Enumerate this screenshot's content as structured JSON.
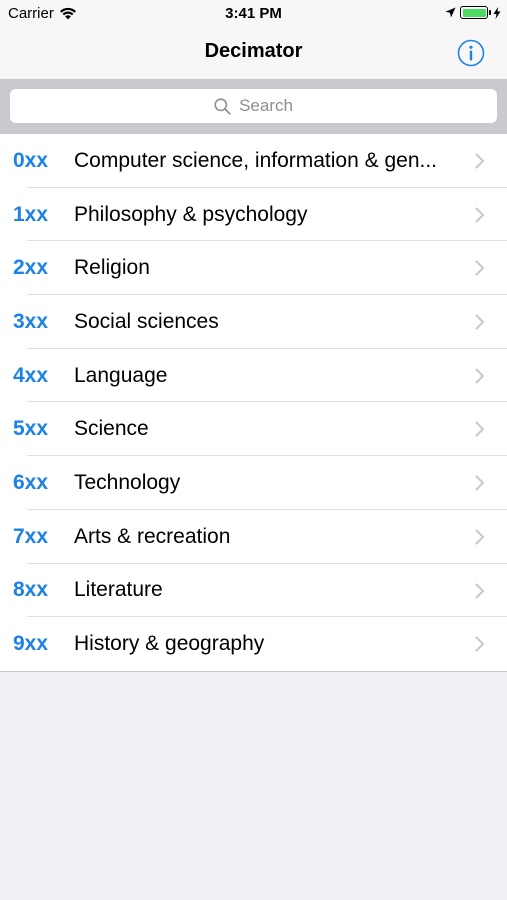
{
  "status_bar": {
    "carrier": "Carrier",
    "time": "3:41 PM",
    "battery_level": 1.0,
    "battery_color": "#4cd964"
  },
  "nav": {
    "title": "Decimator",
    "info_icon": "info-circle-icon"
  },
  "search": {
    "placeholder": "Search",
    "icon": "search-icon"
  },
  "accent_color": "#1d82e6",
  "categories": [
    {
      "code": "0xx",
      "label": "Computer science, information & gen..."
    },
    {
      "code": "1xx",
      "label": "Philosophy & psychology"
    },
    {
      "code": "2xx",
      "label": "Religion"
    },
    {
      "code": "3xx",
      "label": "Social sciences"
    },
    {
      "code": "4xx",
      "label": "Language"
    },
    {
      "code": "5xx",
      "label": "Science"
    },
    {
      "code": "6xx",
      "label": "Technology"
    },
    {
      "code": "7xx",
      "label": "Arts & recreation"
    },
    {
      "code": "8xx",
      "label": "Literature"
    },
    {
      "code": "9xx",
      "label": "History & geography"
    }
  ]
}
